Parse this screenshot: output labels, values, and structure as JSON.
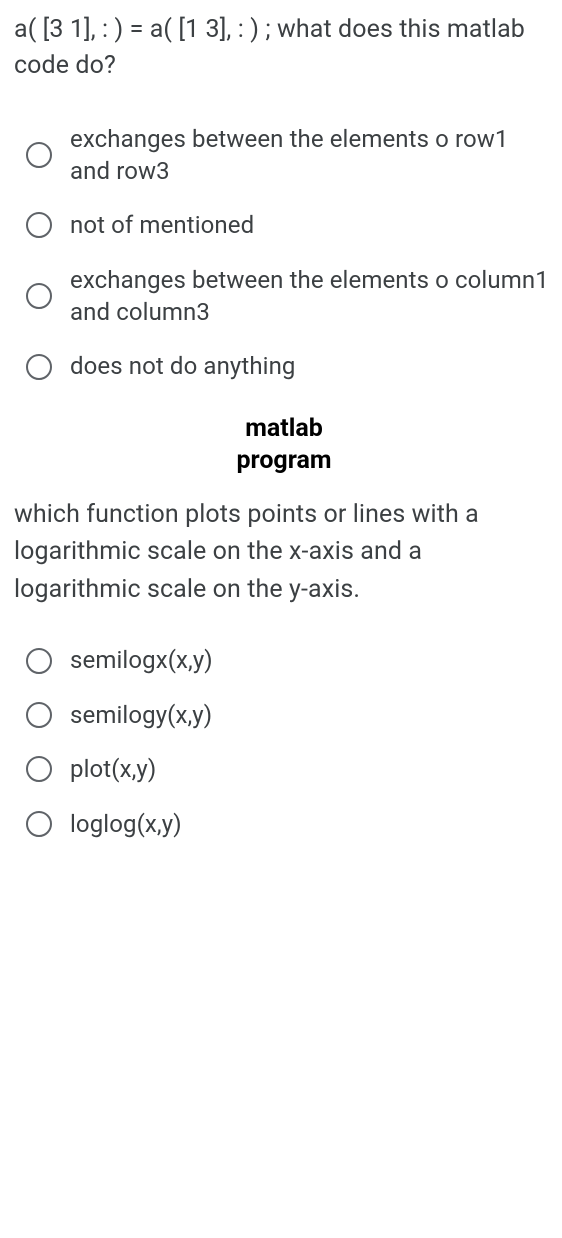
{
  "q1": {
    "text": "a( [3 1], : ) = a( [1 3], : ) ; what does this matlab code do?",
    "options": [
      "exchanges between the elements o row1 and row3",
      "not of mentioned",
      "exchanges between the elements o column1 and column3",
      "does not do anything"
    ]
  },
  "section_header": {
    "line1": "matlab",
    "line2": "program"
  },
  "q2": {
    "text": "which function plots points or lines with a logarithmic scale on the x-axis and a logarithmic scale on the y-axis.",
    "options": [
      "semilogx(x,y)",
      "semilogy(x,y)",
      "plot(x,y)",
      "loglog(x,y)"
    ]
  }
}
